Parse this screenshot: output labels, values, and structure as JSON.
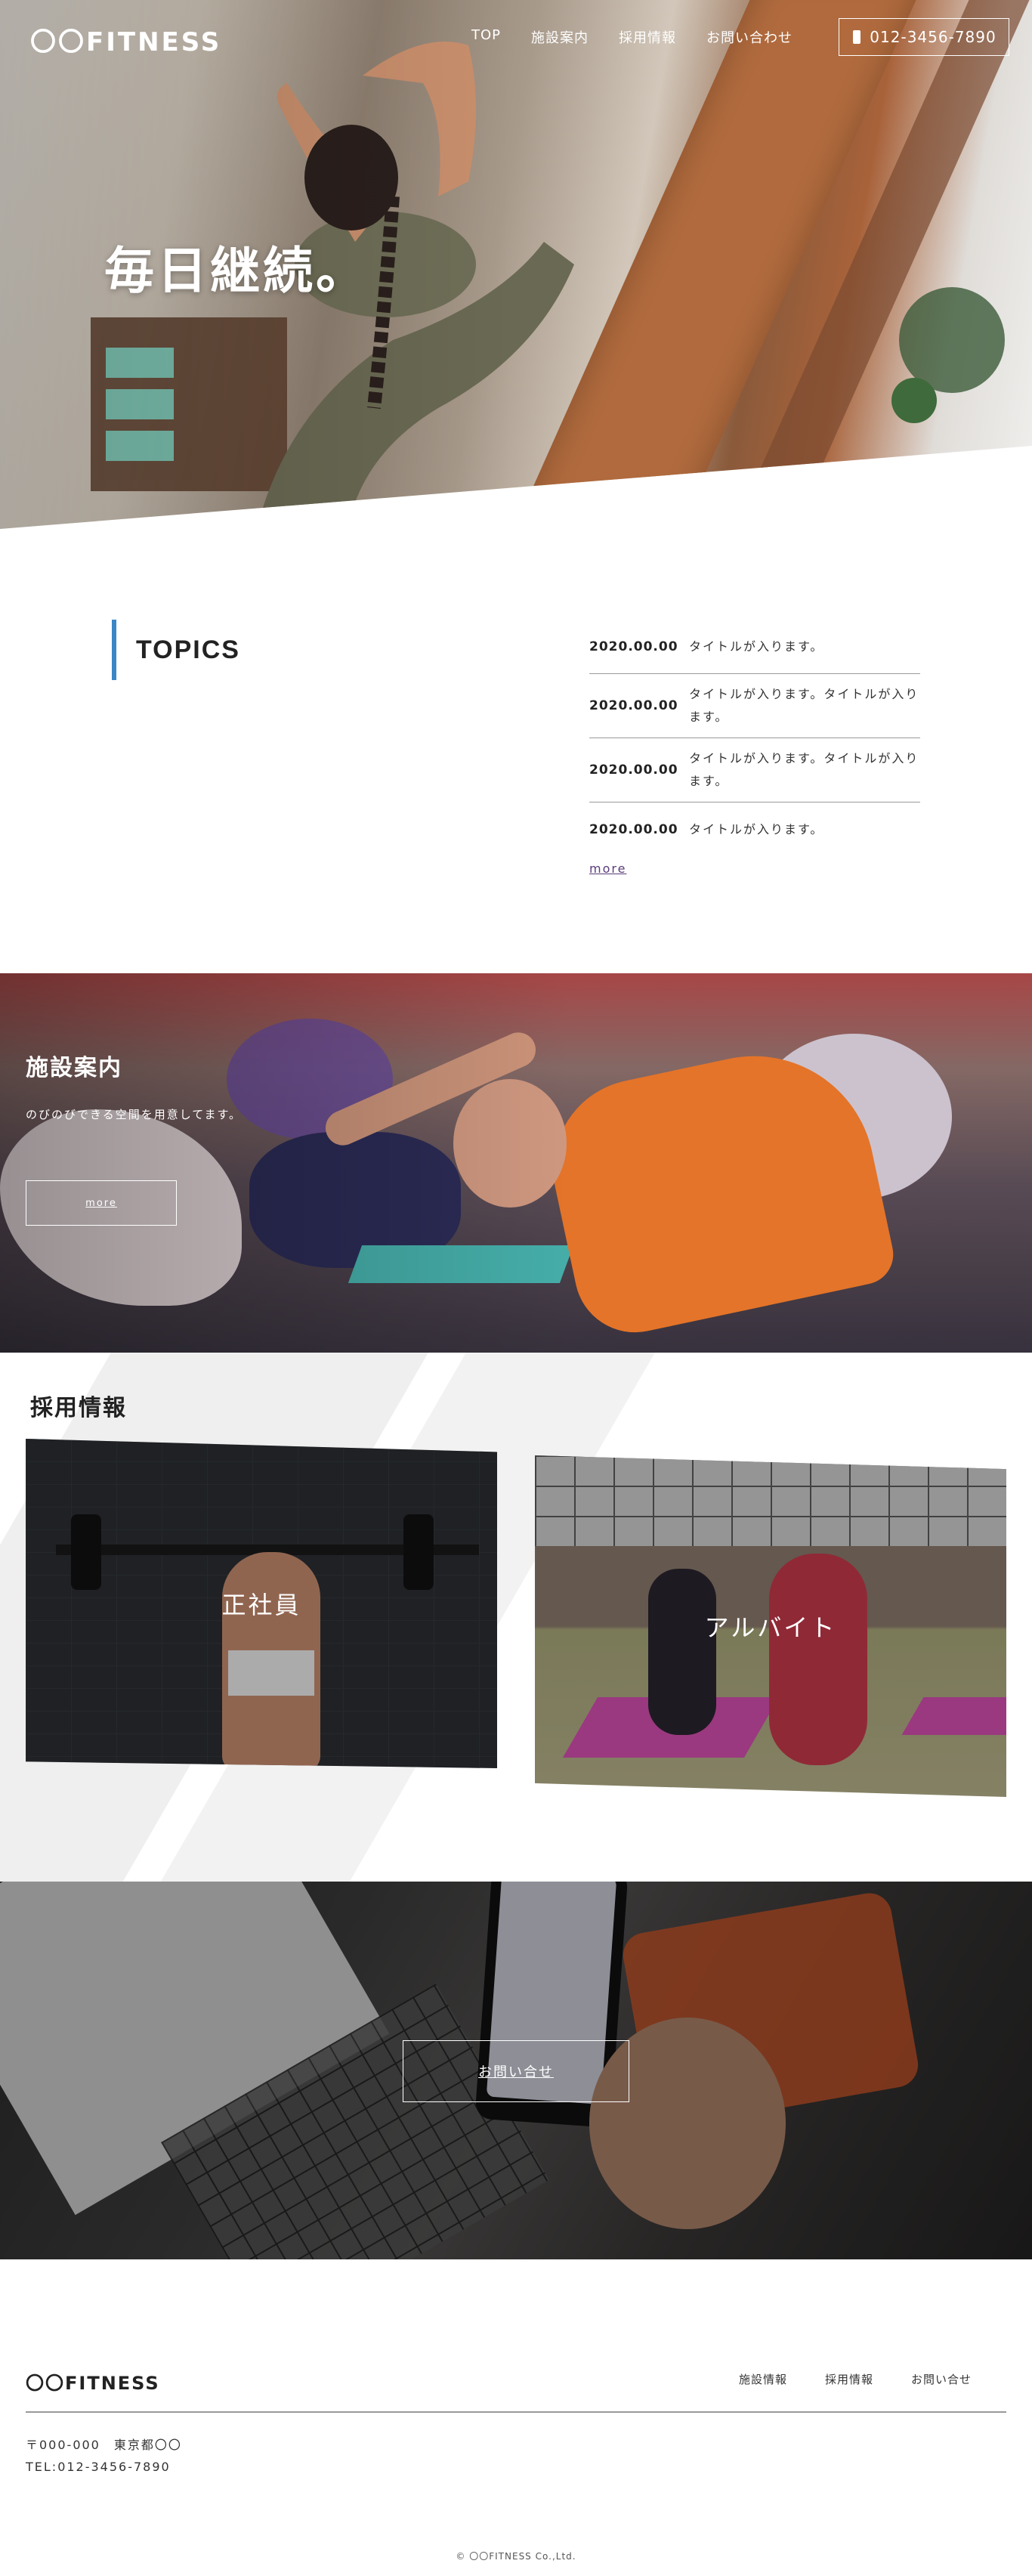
{
  "nav": {
    "logo": "〇〇FITNESS",
    "menu": [
      "TOP",
      "施設案内",
      "採用情報",
      "お問い合わせ"
    ],
    "tel": "012-3456-7890",
    "tel_icon": "phone-icon"
  },
  "hero": {
    "headline": "毎日継続。"
  },
  "topics": {
    "heading": "TOPICS",
    "items": [
      {
        "date": "2020.00.00",
        "title": "タイトルが入ります。"
      },
      {
        "date": "2020.00.00",
        "title": "タイトルが入ります。タイトルが入ります。"
      },
      {
        "date": "2020.00.00",
        "title": "タイトルが入ります。タイトルが入ります。"
      },
      {
        "date": "2020.00.00",
        "title": "タイトルが入ります。"
      }
    ],
    "more": "more"
  },
  "facility": {
    "title": "施設案内",
    "subtitle": "のびのびできる空間を用意してます。",
    "more": "more"
  },
  "recruit": {
    "title": "採用情報",
    "cards": [
      {
        "label": "正社員"
      },
      {
        "label": "アルバイト"
      }
    ]
  },
  "contact": {
    "button": "お問い合せ"
  },
  "footer": {
    "logo": "〇〇FITNESS",
    "nav": [
      "施設情報",
      "採用情報",
      "お問い合せ"
    ],
    "address": "〒000-000　東京都〇〇",
    "tel": "TEL:012-3456-7890",
    "copyright": "© 〇〇FITNESS Co.,Ltd."
  },
  "colors": {
    "accent": "#3a86c6",
    "more_link": "#5a3c7a"
  }
}
